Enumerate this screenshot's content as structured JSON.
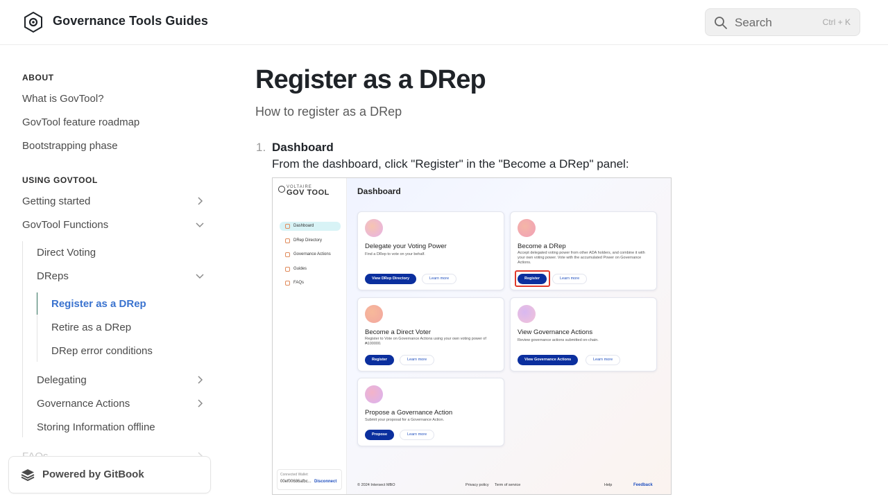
{
  "header": {
    "site_title": "Governance Tools Guides",
    "search_label": "Search",
    "search_shortcut": "Ctrl + K"
  },
  "sidebar": {
    "sections": [
      {
        "title": "ABOUT",
        "items": [
          "What is GovTool?",
          "GovTool feature roadmap",
          "Bootstrapping phase"
        ]
      },
      {
        "title": "USING GOVTOOL",
        "items": [
          "Getting started",
          "GovTool Functions"
        ]
      }
    ],
    "functions": {
      "direct_voting": "Direct Voting",
      "dreps": "DReps",
      "dreps_children": [
        "Register as a DRep",
        "Retire as a DRep",
        "DRep error conditions"
      ],
      "delegating": "Delegating",
      "governance_actions": "Governance Actions",
      "storing_offline": "Storing Information offline"
    },
    "faded_item": "FAQs",
    "active_item": "Register as a DRep",
    "powered_by": "Powered by GitBook"
  },
  "main": {
    "title": "Register as a DRep",
    "description": "How to register as a DRep",
    "steps": [
      {
        "number": "1.",
        "title": "Dashboard",
        "text": "From the dashboard, click \"Register\" in the \"Become a DRep\" panel:"
      }
    ]
  },
  "figure": {
    "brand_small": "VOLTAIRE",
    "brand": "GOV TOOL",
    "nav": [
      "Dashboard",
      "DRep Directory",
      "Governance Actions",
      "Guides",
      "FAQs"
    ],
    "title": "Dashboard",
    "cards": [
      {
        "title": "Delegate your Voting Power",
        "desc": "Find a DRep to vote on your behalf.",
        "button": "View DRep Directory",
        "learn": "Learn more"
      },
      {
        "title": "Become a DRep",
        "desc": "Accept delegated voting power from other ADA holders, and combine it with your own voting power. Vote with the accumulated Power on Governance Actions.",
        "button": "Register",
        "learn": "Learn more"
      },
      {
        "title": "Become a Direct Voter",
        "desc": "Register to Vote on Governance Actions using your own voting power of ₳100000.",
        "button": "Register",
        "learn": "Learn more"
      },
      {
        "title": "View Governance Actions",
        "desc": "Review governance actions submitted on-chain.",
        "button": "View Governance Actions",
        "learn": "Learn more"
      },
      {
        "title": "Propose a Governance Action",
        "desc": "Submit your proposal for a Governance Action.",
        "button": "Propose",
        "learn": "Learn more"
      }
    ],
    "wallet_label": "Connected Wallet:",
    "wallet_id": "00ef00686afbc...",
    "disconnect": "Disconnect",
    "copyright": "© 2024 Intersect MBO",
    "privacy": "Privacy policy",
    "terms": "Term of service",
    "help": "Help",
    "feedback": "Feedback"
  },
  "colors": {
    "accent": "#3a73cf",
    "active_border": "#2f6f5a",
    "figure_button": "#0b2f9e",
    "figure_highlight": "#e0392b"
  }
}
